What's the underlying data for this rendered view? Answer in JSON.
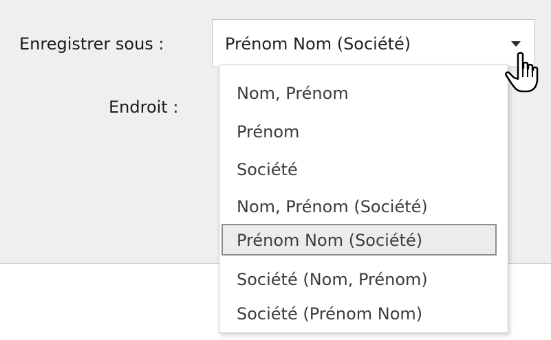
{
  "labels": {
    "save_as": "Enregistrer sous :",
    "location": "Endroit :"
  },
  "save_as_select": {
    "selected_value": "Prénom Nom (Société)",
    "options": [
      "Nom, Prénom",
      "Prénom",
      "Société",
      "Nom, Prénom (Société)",
      "Prénom Nom (Société)",
      "Société (Nom, Prénom)",
      "Société (Prénom Nom)"
    ],
    "highlighted_index": 4
  },
  "icons": {
    "dropdown_arrow": "chevron-down-icon",
    "pointer": "hand-pointer-icon"
  }
}
